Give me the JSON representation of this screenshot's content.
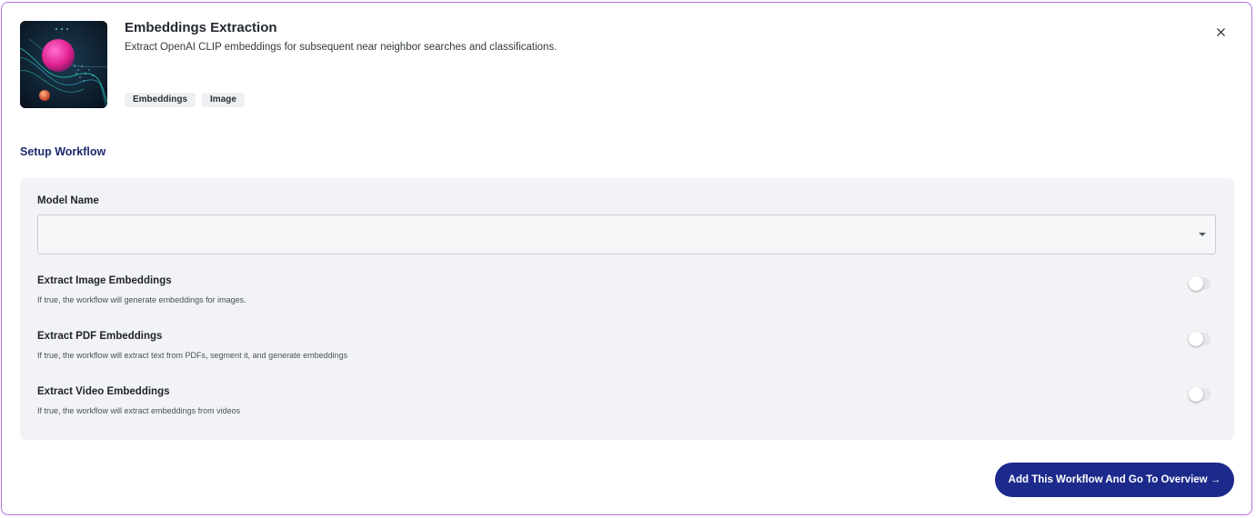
{
  "header": {
    "title": "Embeddings Extraction",
    "description": "Extract OpenAI CLIP embeddings for subsequent near neighbor searches and classifications.",
    "tags": [
      "Embeddings",
      "Image"
    ],
    "close_icon": "close-icon"
  },
  "section": {
    "title": "Setup Workflow"
  },
  "form": {
    "model_name": {
      "label": "Model Name",
      "value": ""
    },
    "options": [
      {
        "title": "Extract Image Embeddings",
        "help": "If true, the workflow will generate embeddings for images.",
        "enabled": false
      },
      {
        "title": "Extract PDF Embeddings",
        "help": "If true, the workflow will extract text from PDFs, segment it, and generate embeddings",
        "enabled": false
      },
      {
        "title": "Extract Video Embeddings",
        "help": "If true, the workflow will extract embeddings from videos",
        "enabled": false
      }
    ]
  },
  "footer": {
    "cta_label": "Add This Workflow And Go To Overview →"
  },
  "colors": {
    "primary": "#1c2a8c",
    "section_title": "#1c2a6e",
    "panel_bg": "#f2f3f6",
    "dialog_border": "#b46ee0"
  }
}
